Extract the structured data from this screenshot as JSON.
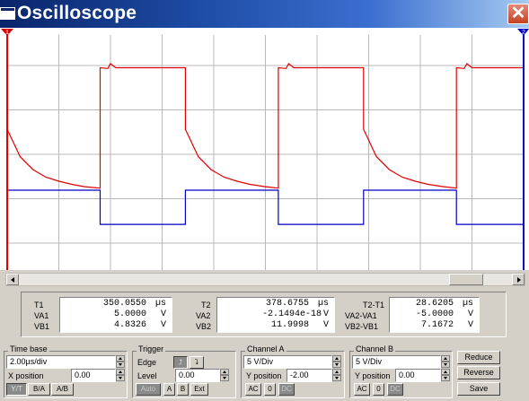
{
  "window": {
    "title": "Oscilloscope",
    "close_glyph": "✕"
  },
  "colors": {
    "channel_a_trace": "#e00000",
    "channel_b_trace": "#0000c8",
    "titlebar": "#0a246a",
    "grid": "#b8b8b8"
  },
  "icons": {
    "title": "window-icon",
    "close": "close-icon",
    "cursor1": "cursor-1-marker-icon",
    "cursor2": "cursor-2-marker-icon"
  },
  "cursors": {
    "t1_label": "1",
    "t2_label": "2"
  },
  "chart_data": {
    "type": "line",
    "divisions": {
      "x": 10,
      "y": 8
    },
    "series": [
      {
        "id": "channel-a",
        "color": "#e00000",
        "points": [
          [
            0.0,
            -1.8
          ],
          [
            0.25,
            -2.6
          ],
          [
            0.5,
            -2.98
          ],
          [
            0.75,
            -3.2
          ],
          [
            1.0,
            -3.32
          ],
          [
            1.25,
            -3.41
          ],
          [
            1.5,
            -3.48
          ],
          [
            1.8,
            -3.52
          ],
          [
            1.8,
            0.0
          ],
          [
            1.95,
            -0.02
          ],
          [
            2.0,
            0.12
          ],
          [
            2.1,
            0.0
          ],
          [
            3.45,
            0.0
          ],
          [
            3.45,
            -1.8
          ],
          [
            3.7,
            -2.6
          ],
          [
            3.95,
            -2.98
          ],
          [
            4.2,
            -3.2
          ],
          [
            4.45,
            -3.32
          ],
          [
            4.7,
            -3.41
          ],
          [
            5.0,
            -3.48
          ],
          [
            5.25,
            -3.52
          ],
          [
            5.25,
            0.0
          ],
          [
            5.4,
            -0.02
          ],
          [
            5.45,
            0.12
          ],
          [
            5.55,
            0.0
          ],
          [
            6.9,
            0.0
          ],
          [
            6.9,
            -1.8
          ],
          [
            7.15,
            -2.6
          ],
          [
            7.4,
            -2.98
          ],
          [
            7.65,
            -3.2
          ],
          [
            7.9,
            -3.32
          ],
          [
            8.15,
            -3.41
          ],
          [
            8.45,
            -3.48
          ],
          [
            8.7,
            -3.52
          ],
          [
            8.7,
            0.0
          ],
          [
            8.85,
            -0.02
          ],
          [
            8.9,
            0.12
          ],
          [
            9.0,
            0.0
          ],
          [
            10.0,
            0.0
          ]
        ]
      },
      {
        "id": "channel-b",
        "color": "#0000c8",
        "points": [
          [
            0.0,
            -0.9
          ],
          [
            0.0,
            0.0
          ],
          [
            1.8,
            0.0
          ],
          [
            1.8,
            -1.0
          ],
          [
            3.45,
            -1.0
          ],
          [
            3.45,
            0.0
          ],
          [
            5.25,
            0.0
          ],
          [
            5.25,
            -1.0
          ],
          [
            6.9,
            -1.0
          ],
          [
            6.9,
            0.0
          ],
          [
            8.7,
            0.0
          ],
          [
            8.7,
            -1.0
          ],
          [
            10.0,
            -1.0
          ]
        ]
      }
    ],
    "x_offset_div": 0.0,
    "channel_a": {
      "volts_per_div": 5,
      "y_position_div": -2.0
    },
    "channel_b": {
      "volts_per_div": 5,
      "y_position_div": 0.0
    }
  },
  "readouts": {
    "col1": {
      "labels": [
        "T1",
        "VA1",
        "VB1"
      ],
      "rows": [
        {
          "value": "350.0550",
          "unit": "µs"
        },
        {
          "value": "5.0000",
          "unit": "V"
        },
        {
          "value": "4.8326",
          "unit": "V"
        }
      ]
    },
    "col2": {
      "labels": [
        "T2",
        "VA2",
        "VB2"
      ],
      "rows": [
        {
          "value": "378.6755",
          "unit": "µs"
        },
        {
          "value": "-2.1494e-18",
          "unit": "V"
        },
        {
          "value": "11.9998",
          "unit": "V"
        }
      ]
    },
    "col3": {
      "labels": [
        "T2-T1",
        "VA2-VA1",
        "VB2-VB1"
      ],
      "rows": [
        {
          "value": "28.6205",
          "unit": "µs"
        },
        {
          "value": "-5.0000",
          "unit": "V"
        },
        {
          "value": "7.1672",
          "unit": "V"
        }
      ]
    }
  },
  "timebase": {
    "title": "Time base",
    "value": "2.00µs/div",
    "xpos_label": "X position",
    "xpos_value": "0.00",
    "modes": [
      "Y/T",
      "B/A",
      "A/B"
    ]
  },
  "trigger": {
    "title": "Trigger",
    "edge_label": "Edge",
    "edge_rising": "⮥",
    "edge_falling": "⮧",
    "level_label": "Level",
    "level_value": "0.00",
    "sources": [
      "Auto",
      "A",
      "B",
      "Ext"
    ]
  },
  "channel_a": {
    "title": "Channel A",
    "value": "5 V/Div",
    "ypos_label": "Y position",
    "ypos_value": "-2.00",
    "coupling": [
      "AC",
      "0",
      "DC"
    ]
  },
  "channel_b": {
    "title": "Channel B",
    "value": "5 V/Div",
    "ypos_label": "Y position",
    "ypos_value": "0.00",
    "coupling": [
      "AC",
      "0",
      "DC"
    ]
  },
  "actions": {
    "reduce": "Reduce",
    "reverse": "Reverse",
    "save": "Save"
  }
}
